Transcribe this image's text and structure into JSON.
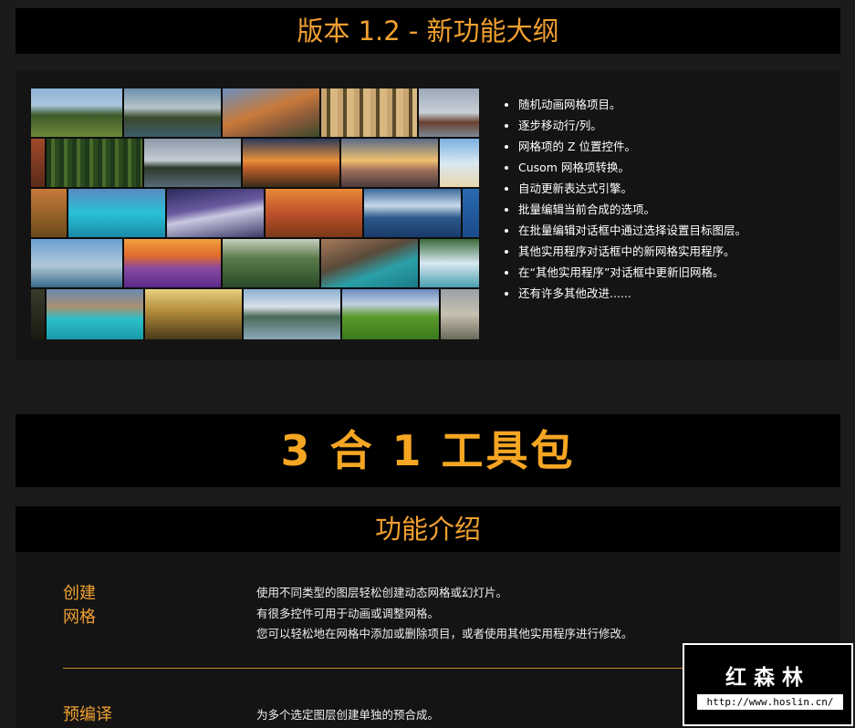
{
  "header": {
    "version_title": "版本 1.2 - 新功能大纲"
  },
  "features": [
    "随机动画网格项目。",
    "逐步移动行/列。",
    "网格项的 Z 位置控件。",
    "Cusom 网格项转换。",
    "自动更新表达式引擎。",
    "批量编辑当前合成的选项。",
    "在批量编辑对话框中通过选择设置目标图层。",
    "其他实用程序对话框中的新网格实用程序。",
    "在“其他实用程序”对话框中更新旧网格。",
    "还有许多其他改进......"
  ],
  "toolkit": {
    "title": "3 合 1 工具包"
  },
  "intro": {
    "title": "功能介绍",
    "items": [
      {
        "label_line1": "创建",
        "label_line2": "网格",
        "desc": [
          "使用不同类型的图层轻松创建动态网格或幻灯片。",
          "有很多控件可用于动画或调整网格。",
          "您可以轻松地在网格中添加或删除项目，或者使用其他实用程序进行修改。"
        ]
      },
      {
        "label": "预编译",
        "desc": [
          "为多个选定图层创建单独的预合成。"
        ]
      }
    ]
  },
  "watermark": {
    "name": "红森林",
    "url": "http://www.hoslin.cn/"
  },
  "colors": {
    "accent": "#f0a030",
    "background": "#1b1b1b",
    "bar": "#000000"
  },
  "mosaic_images": [
    "mountain-cabin-meadow",
    "lake-trees",
    "dolomites-peaks",
    "autumn-birch-forest",
    "rowboat-lake",
    "forest-red-trees",
    "pine-forest",
    "island-in-lake",
    "sunset-fields",
    "sunrise-mountains",
    "beach-palm",
    "autumn-trees",
    "tropical-lagoon",
    "purple-mountains",
    "orange-forest",
    "alpine-lake-reflection",
    "blue-lake",
    "lone-tree-lake",
    "lavender-sunset",
    "mossy-forest",
    "turquoise-river-canyon",
    "waterfall",
    "dark-forest-edge",
    "turquoise-lake-boat",
    "golden-forest",
    "mountain-lake-reflection",
    "green-hills-cabin",
    "cliff-rocks"
  ]
}
